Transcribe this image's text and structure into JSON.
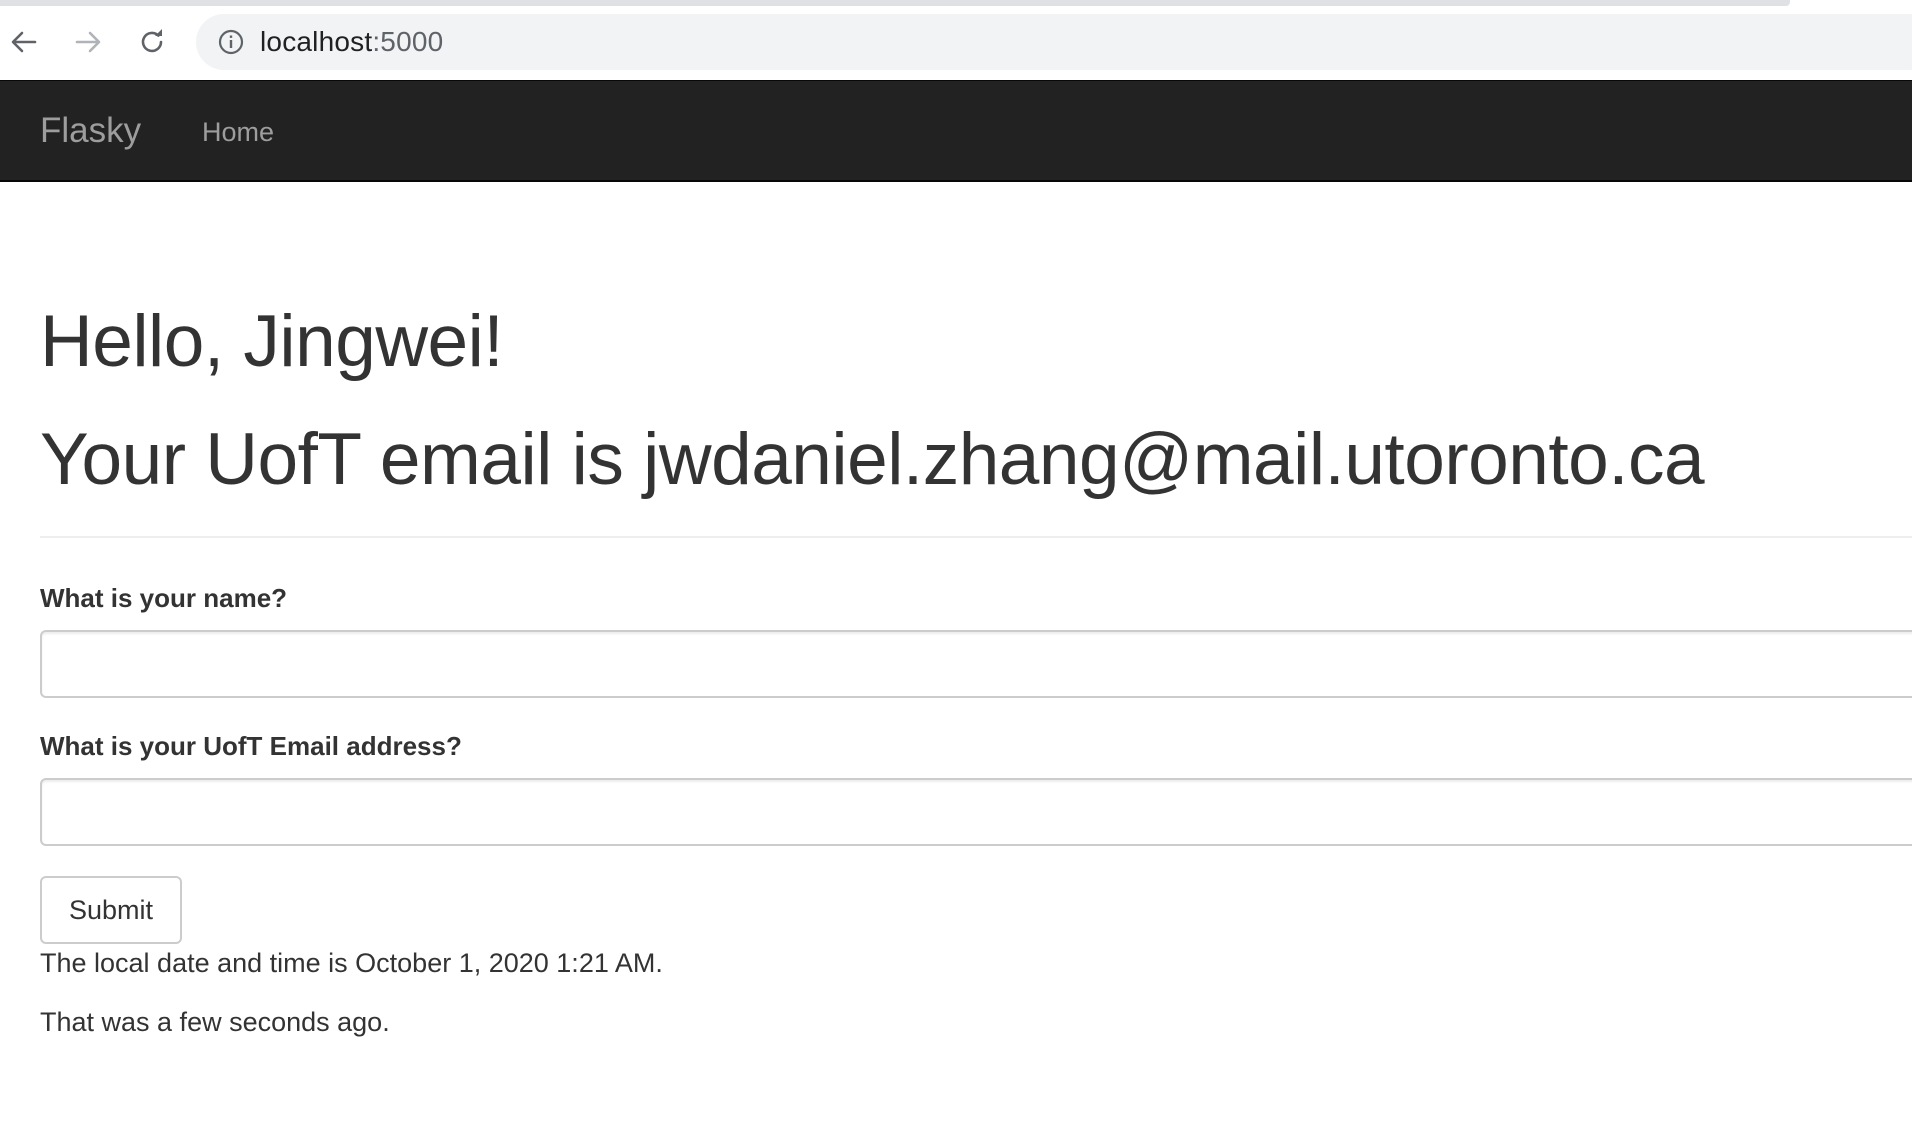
{
  "browser": {
    "url_host": "localhost",
    "url_port": ":5000",
    "icons": {
      "back": "arrow-left-icon",
      "forward": "arrow-right-icon",
      "reload": "reload-icon",
      "info": "info-icon"
    }
  },
  "navbar": {
    "brand": "Flasky",
    "home": "Home",
    "background_color": "#222222",
    "link_color": "#9d9d9d"
  },
  "main": {
    "greeting": "Hello, Jingwei!",
    "email_heading": "Your UofT email is jwdaniel.zhang@mail.utoronto.ca",
    "form": {
      "name_label": "What is your name?",
      "name_value": "",
      "email_label": "What is your UofT Email address?",
      "email_value": "",
      "submit_label": "Submit"
    },
    "local_time_text": "The local date and time is October 1, 2020 1:21 AM.",
    "relative_time_text": "That was a few seconds ago."
  }
}
